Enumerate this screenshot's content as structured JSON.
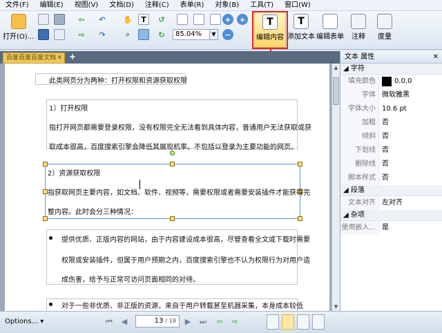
{
  "menubar": {
    "items": [
      "文件(F)",
      "编辑(E)",
      "视图(V)",
      "文档(D)",
      "注释(C)",
      "表单(R)",
      "对象(B)",
      "工具(T)",
      "窗口(W)"
    ]
  },
  "toolbar": {
    "open_label": "打开(O)...",
    "zoom_value": "85.04%",
    "edit_content_label": "编辑内容",
    "add_text_label": "添加文本",
    "edit_form_label": "编辑表单",
    "annotate_label": "注释",
    "measure_label": "度量"
  },
  "tab": {
    "title": "百度百度百度文档"
  },
  "document": {
    "intro": "此类网页分为两种：打开权限和资源获取权限",
    "s1_title": "1）打开权限",
    "s1_line1": "指打开网页都需要登录权限，没有权限完全无法看到具体内容，普通用户无法获取或获",
    "s1_line2": "取成本很高，百度搜索引擎会降低其展现机率。不包括以登录为主要功能的网页。",
    "s2_title": "2）资源获取权限",
    "s2_line1": "指获取网页主要内容，如文档、软件、视频等，需要权限或者需要安装插件才能获得完",
    "s2_line2": "整内容。此时会分三种情况：",
    "b1_line1": "提供优质、正版内容的网站，由于内容建设成本很高，尽管查看全文或下载时需要",
    "b1_line2": "权限或安装插件，但属于用户预期之内，百度搜索引擎也不认为权限行为对用户造",
    "b1_line3": "成伤害，给予与正常可访问页面相同的对待。",
    "b2_line1": "对于一些非优质、非正版的资源，来自于用户转载甚至机器采集，本身成本较低"
  },
  "panel": {
    "title": "文本 属性",
    "section_font": "字符",
    "fill_color_key": "填充颜色",
    "fill_color_val": "0,0,0",
    "font_key": "字体",
    "font_val": "微软雅黑",
    "size_key": "字体大小",
    "size_val": "10.6 pt",
    "bold_key": "加粗",
    "bold_val": "否",
    "italic_key": "倾斜",
    "italic_val": "否",
    "underline_key": "下划线",
    "underline_val": "否",
    "strike_key": "删除线",
    "strike_val": "否",
    "script_key": "脚本样式",
    "script_val": "否",
    "section_para": "段落",
    "align_key": "文本对齐",
    "align_val": "左对齐",
    "section_misc": "杂项",
    "embed_key": "使用嵌入...",
    "embed_val": "是"
  },
  "statusbar": {
    "options_label": "Options...",
    "page_current": "13",
    "page_total": "/ 18"
  },
  "colors": {
    "highlight": "#e2242a",
    "selection": "#5b8fd6",
    "active_tool": "#ffd76a"
  }
}
